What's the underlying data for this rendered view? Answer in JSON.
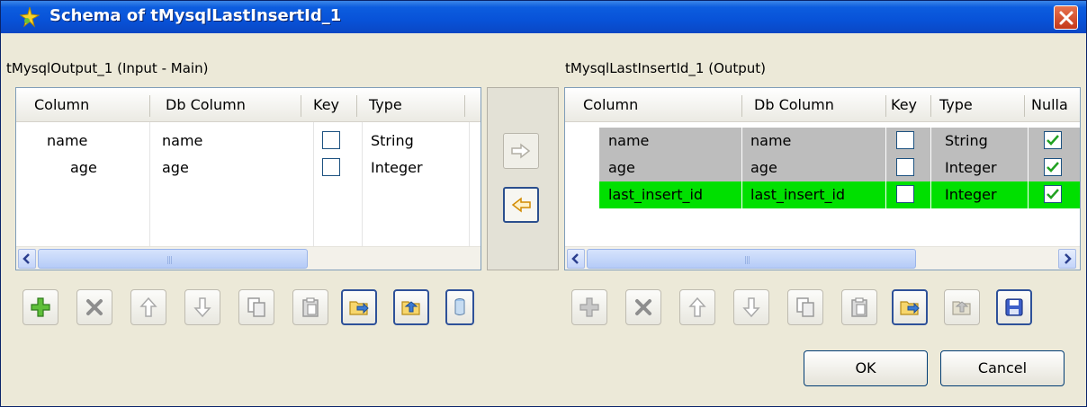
{
  "window": {
    "title": "Schema of tMysqlLastInsertId_1"
  },
  "left": {
    "label": "tMysqlOutput_1 (Input - Main)",
    "columns": [
      "Column",
      "Db Column",
      "Key",
      "Type"
    ],
    "rows": [
      {
        "column": "name",
        "db_column": "name",
        "key": false,
        "type": "String"
      },
      {
        "column": "age",
        "db_column": "age",
        "key": false,
        "type": "Integer"
      }
    ]
  },
  "right": {
    "label": "tMysqlLastInsertId_1 (Output)",
    "columns": [
      "Column",
      "Db Column",
      "Key",
      "Type",
      "Nulla"
    ],
    "rows": [
      {
        "column": "name",
        "db_column": "name",
        "key": false,
        "type": "String",
        "nullable": true
      },
      {
        "column": "age",
        "db_column": "age",
        "key": false,
        "type": "Integer",
        "nullable": true
      },
      {
        "column": "last_insert_id",
        "db_column": "last_insert_id",
        "key": false,
        "type": "Integer",
        "nullable": true
      }
    ]
  },
  "buttons": {
    "ok": "OK",
    "cancel": "Cancel"
  },
  "colors": {
    "title_bar": "#0852D8",
    "row_readonly": "#BDBDBD",
    "row_highlight": "#00E000"
  }
}
